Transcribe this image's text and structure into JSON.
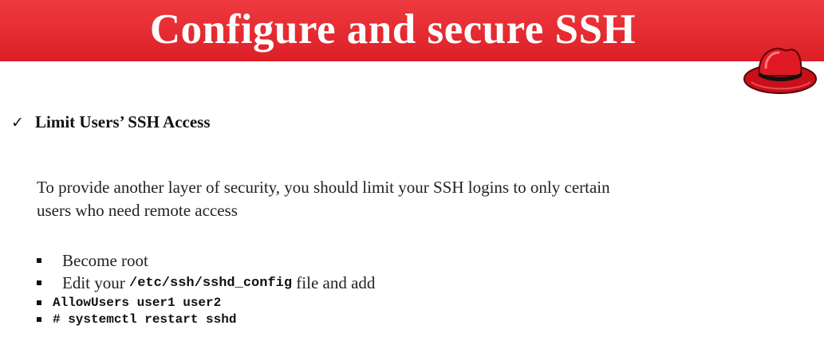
{
  "header": {
    "title": "Configure and secure SSH",
    "background_color": "#e52830",
    "title_color": "#ffffff",
    "logo_icon": "red-fedora-hat-icon"
  },
  "section": {
    "check_glyph": "✓",
    "title": "Limit Users’ SSH Access"
  },
  "paragraph": {
    "line1": "To provide another layer of security, you should limit your SSH logins to only certain",
    "line2": "users who need remote access"
  },
  "bullets": {
    "item1": "Become root",
    "item2_before": "Edit your ",
    "item2_code": "/etc/ssh/sshd_config",
    "item2_after": " file and add",
    "item3_code": "AllowUsers user1 user2",
    "item4_code": "# systemctl restart sshd"
  }
}
